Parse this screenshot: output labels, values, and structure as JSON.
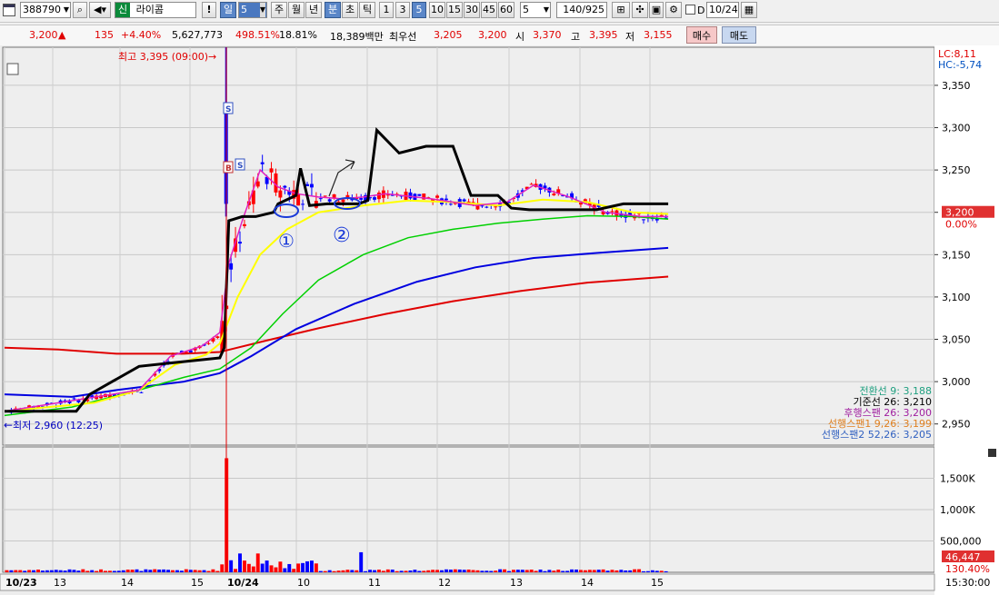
{
  "toolbar": {
    "code": "388790",
    "market_badge": "신",
    "stock_name": "라이콤",
    "alert_label": "!",
    "period_label": "일",
    "period_value": "5",
    "periods": [
      "주",
      "월",
      "년",
      "분",
      "초",
      "틱"
    ],
    "minutes": [
      "1",
      "3",
      "5",
      "10",
      "15",
      "30",
      "45",
      "60"
    ],
    "count_value": "5",
    "view_count": "140/925",
    "checkbox_label": "D",
    "date_value": "10/24"
  },
  "quote": {
    "price": "3,200",
    "change": "135",
    "change_pct": "+4.40%",
    "volume": "5,627,773",
    "vol_ratio": "498.51%",
    "turnover": "18.81%",
    "amount": "18,389백만",
    "best_label": "최우선",
    "best_ask": "3,205",
    "best_bid": "3,200",
    "open_label": "시",
    "open": "3,370",
    "high_label": "고",
    "high": "3,395",
    "low_label": "저",
    "low": "3,155",
    "buy_label": "매수",
    "sell_label": "매도"
  },
  "colors": {
    "up": "#ff0000",
    "down": "#0000ff",
    "price_tag_bg": "#e03030",
    "line_ma5": "#e020c0",
    "line_ma10": "#ffff00",
    "line_ma20": "#00d000",
    "line_ma60": "#0000e0",
    "line_ma120": "#e00000",
    "kijun": "#000000"
  },
  "chart_data": {
    "type": "candlestick",
    "price_axis": {
      "ticks": [
        "3,350",
        "3,300",
        "3,250",
        "3,200",
        "3,150",
        "3,100",
        "3,050",
        "3,000",
        "2,950"
      ],
      "ylim": [
        2925,
        3395
      ]
    },
    "volume_axis": {
      "ticks": [
        "1,500K",
        "1,000K",
        "500,000"
      ]
    },
    "x_ticks": [
      "10/23",
      "13",
      "14",
      "15",
      "10/24",
      "10",
      "11",
      "12",
      "13",
      "14",
      "15"
    ],
    "time_label": "15:30:00",
    "top_right": {
      "lc": "LC:8,11",
      "hc": "HC:-5,74"
    },
    "max_label": "최고 3,395 (09:00)",
    "min_label": "최저 2,960 (12:25)",
    "current_price_tag": "3,200",
    "current_pct_tag": "0.00%",
    "volume_tag": "46,447",
    "volume_pct_tag": "130.40%",
    "annotations": [
      "①",
      "②"
    ],
    "markers": [
      "S",
      "S",
      "B"
    ],
    "ichimoku_legend": [
      {
        "label": "전환선 9: 3,188",
        "color": "#20a080"
      },
      {
        "label": "기준선 26: 3,210",
        "color": "#000000"
      },
      {
        "label": "후행스팬 26: 3,200",
        "color": "#a020a0"
      },
      {
        "label": "선행스팬1 9,26: 3,199",
        "color": "#e08020"
      },
      {
        "label": "선행스팬2 52,26: 3,205",
        "color": "#3060c0"
      }
    ],
    "lines": {
      "kijun": [
        [
          0,
          2965
        ],
        [
          16,
          2965
        ],
        [
          19,
          2985
        ],
        [
          24,
          3000
        ],
        [
          30,
          3018
        ],
        [
          37,
          3022
        ],
        [
          48,
          3028
        ],
        [
          49,
          3040
        ],
        [
          50,
          3190
        ],
        [
          53,
          3195
        ],
        [
          56,
          3195
        ],
        [
          60,
          3200
        ],
        [
          61,
          3210
        ],
        [
          65,
          3220
        ],
        [
          66,
          3252
        ],
        [
          68,
          3208
        ],
        [
          72,
          3210
        ],
        [
          79,
          3210
        ],
        [
          81,
          3214
        ],
        [
          83,
          3297
        ],
        [
          88,
          3270
        ],
        [
          94,
          3278
        ],
        [
          100,
          3278
        ],
        [
          104,
          3220
        ],
        [
          110,
          3220
        ],
        [
          113,
          3205
        ],
        [
          117,
          3203
        ],
        [
          132,
          3203
        ],
        [
          138,
          3210
        ],
        [
          148,
          3210
        ]
      ],
      "ma5": [
        [
          0,
          2965
        ],
        [
          30,
          2990
        ],
        [
          37,
          3030
        ],
        [
          44,
          3042
        ],
        [
          48,
          3058
        ],
        [
          50,
          3140
        ],
        [
          53,
          3190
        ],
        [
          57,
          3250
        ],
        [
          61,
          3230
        ],
        [
          65,
          3222
        ],
        [
          70,
          3218
        ],
        [
          75,
          3216
        ],
        [
          80,
          3218
        ],
        [
          85,
          3222
        ],
        [
          95,
          3216
        ],
        [
          105,
          3208
        ],
        [
          112,
          3212
        ],
        [
          118,
          3232
        ],
        [
          126,
          3218
        ],
        [
          134,
          3200
        ],
        [
          142,
          3195
        ],
        [
          148,
          3195
        ]
      ],
      "ma10": [
        [
          0,
          2965
        ],
        [
          20,
          2975
        ],
        [
          30,
          2990
        ],
        [
          38,
          3020
        ],
        [
          45,
          3032
        ],
        [
          48,
          3045
        ],
        [
          52,
          3100
        ],
        [
          57,
          3150
        ],
        [
          63,
          3180
        ],
        [
          70,
          3200
        ],
        [
          80,
          3208
        ],
        [
          90,
          3214
        ],
        [
          100,
          3212
        ],
        [
          110,
          3208
        ],
        [
          120,
          3215
        ],
        [
          130,
          3212
        ],
        [
          140,
          3200
        ],
        [
          148,
          3198
        ]
      ],
      "ma20": [
        [
          0,
          2960
        ],
        [
          15,
          2970
        ],
        [
          30,
          2990
        ],
        [
          40,
          3005
        ],
        [
          48,
          3015
        ],
        [
          55,
          3040
        ],
        [
          62,
          3080
        ],
        [
          70,
          3120
        ],
        [
          80,
          3150
        ],
        [
          90,
          3170
        ],
        [
          100,
          3180
        ],
        [
          110,
          3187
        ],
        [
          120,
          3192
        ],
        [
          130,
          3196
        ],
        [
          140,
          3195
        ],
        [
          148,
          3192
        ]
      ],
      "ma60": [
        [
          0,
          2985
        ],
        [
          15,
          2982
        ],
        [
          25,
          2990
        ],
        [
          40,
          3000
        ],
        [
          48,
          3010
        ],
        [
          55,
          3030
        ],
        [
          65,
          3062
        ],
        [
          78,
          3092
        ],
        [
          92,
          3118
        ],
        [
          105,
          3135
        ],
        [
          118,
          3146
        ],
        [
          132,
          3152
        ],
        [
          148,
          3158
        ]
      ],
      "ma120": [
        [
          0,
          3040
        ],
        [
          12,
          3038
        ],
        [
          25,
          3033
        ],
        [
          40,
          3033
        ],
        [
          48,
          3035
        ],
        [
          58,
          3048
        ],
        [
          70,
          3063
        ],
        [
          85,
          3080
        ],
        [
          100,
          3095
        ],
        [
          115,
          3107
        ],
        [
          130,
          3117
        ],
        [
          148,
          3124
        ]
      ]
    }
  }
}
